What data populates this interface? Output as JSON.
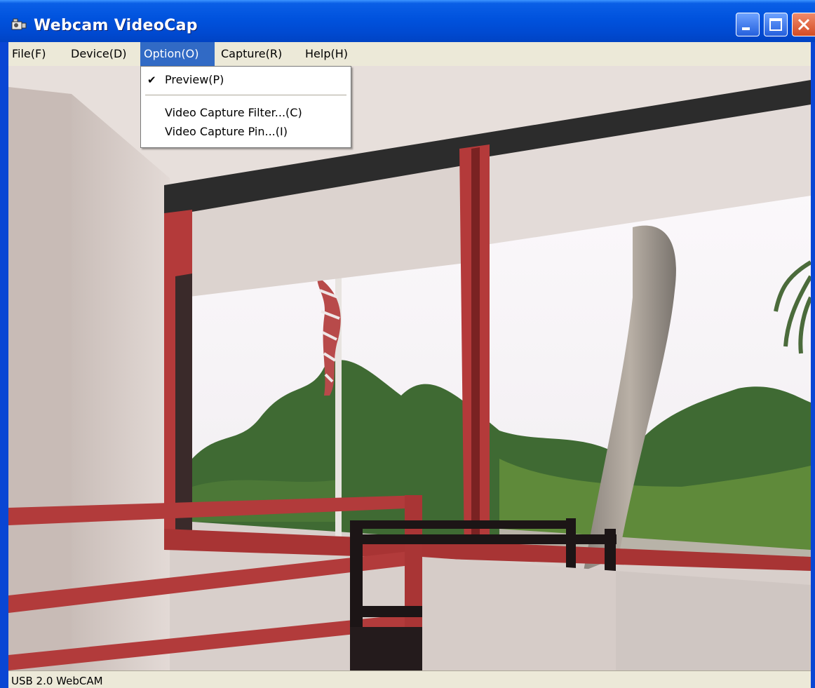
{
  "window": {
    "title": "Webcam VideoCap"
  },
  "menubar": {
    "items": [
      {
        "label": "File(F)"
      },
      {
        "label": "Device(D)"
      },
      {
        "label": "Option(O)",
        "active": true
      },
      {
        "label": "Capture(R)"
      },
      {
        "label": "Help(H)"
      }
    ]
  },
  "option_menu": {
    "items": [
      {
        "label": "Preview(P)",
        "checked": true
      },
      {
        "label": "Video Capture Filter...(C)"
      },
      {
        "label": "Video Capture Pin...(I)"
      }
    ]
  },
  "statusbar": {
    "text": "USB 2.0 WebCAM"
  },
  "icons": {
    "app": "webcam-app-icon",
    "check": "checkmark-icon",
    "minimize": "minimize-icon",
    "maximize": "maximize-icon",
    "close": "close-icon"
  },
  "colors": {
    "titlebar": "#0052dd",
    "menu_highlight": "#316ac5",
    "menubar_bg": "#ece9d8",
    "close_button": "#d34c25"
  }
}
